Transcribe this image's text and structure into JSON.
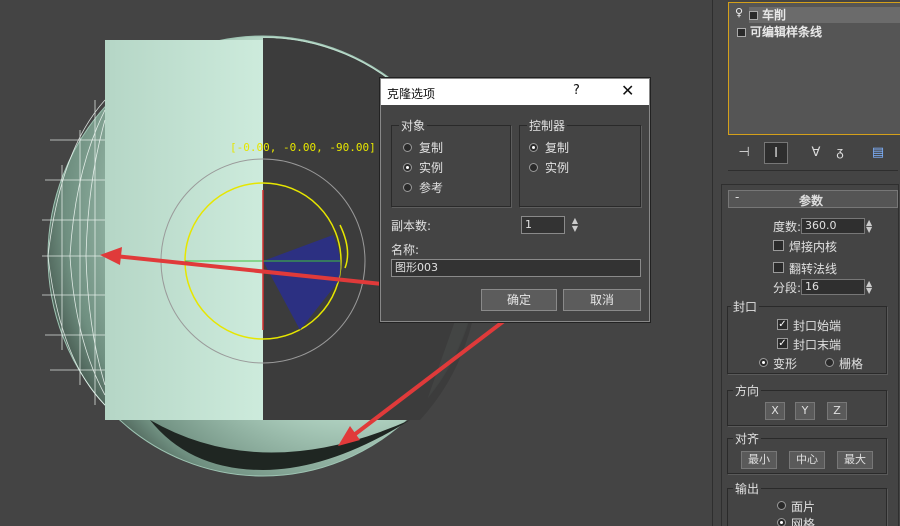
{
  "viewport": {
    "coordinate_readout": "[-0.00, -0.00, -90.00]"
  },
  "modifier_stack": {
    "items": [
      {
        "label": "车削",
        "selected": true
      },
      {
        "label": "可编辑样条线",
        "selected": false
      }
    ]
  },
  "toolbar": {
    "icons": [
      "pin-icon",
      "show-end-result-icon",
      "make-unique-icon",
      "remove-modifier-icon",
      "configure-modifier-sets-icon"
    ]
  },
  "parameters": {
    "title": "参数",
    "degrees_label": "度数:",
    "degrees_value": "360.0",
    "weld_core_label": "焊接内核",
    "weld_core_checked": false,
    "flip_normals_label": "翻转法线",
    "flip_normals_checked": false,
    "segments_label": "分段:",
    "segments_value": "16",
    "capping": {
      "title": "封口",
      "cap_start_label": "封口始端",
      "cap_start_checked": true,
      "cap_end_label": "封口末端",
      "cap_end_checked": true,
      "morph_label": "变形",
      "grid_label": "栅格",
      "selected": "变形"
    },
    "direction": {
      "title": "方向",
      "buttons": [
        "X",
        "Y",
        "Z"
      ]
    },
    "align": {
      "title": "对齐",
      "buttons": [
        "最小",
        "中心",
        "最大"
      ]
    },
    "output": {
      "title": "输出",
      "patch_label": "面片",
      "mesh_label": "网格"
    }
  },
  "clone_dialog": {
    "title": "克隆选项",
    "help": "?",
    "close": "✕",
    "object_group": {
      "title": "对象",
      "options": [
        "复制",
        "实例",
        "参考"
      ],
      "selected": "实例"
    },
    "controller_group": {
      "title": "控制器",
      "options": [
        "复制",
        "实例"
      ],
      "selected": "复制"
    },
    "copies_label": "副本数:",
    "copies_value": "1",
    "name_label": "名称:",
    "name_value": "图形003",
    "ok_label": "确定",
    "cancel_label": "取消"
  },
  "colors": {
    "annotation_arrow": "#e03a3a",
    "gizmo_yellow": "#e6e600",
    "stack_highlight": "#d4a01a"
  }
}
